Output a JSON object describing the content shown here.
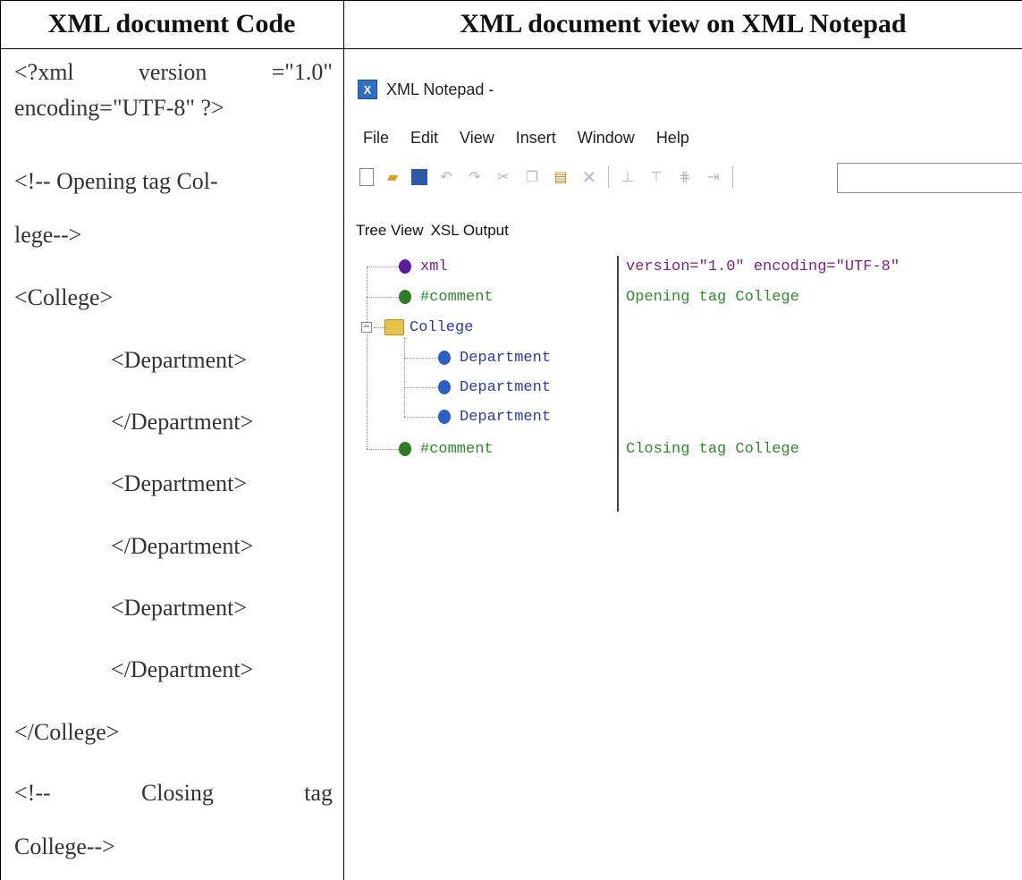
{
  "headers": {
    "left": "XML document Code",
    "right": "XML document view on XML Notepad"
  },
  "code": {
    "l1a": "<?xml",
    "l1b": "version",
    "l1c": "=\"1.0\"",
    "l2": "encoding=\"UTF-8\" ?>",
    "l3": "<!-- Opening tag Col-",
    "l4": "lege-->",
    "l5": "<College>",
    "l6": "<Department>",
    "l7": "</Department>",
    "l8": "<Department>",
    "l9": "</Department>",
    "l10": "<Department>",
    "l11": "</Department>",
    "l12": "</College>",
    "l13a": "<!--",
    "l13b": "Closing",
    "l13c": "tag",
    "l14": "College-->"
  },
  "notepad": {
    "title": "XML Notepad -",
    "app_icon": "X",
    "menu": [
      "File",
      "Edit",
      "View",
      "Insert",
      "Window",
      "Help"
    ],
    "tabs": [
      "Tree View",
      "XSL Output"
    ],
    "tree": {
      "n1": "xml",
      "n2": "#comment",
      "n3": "College",
      "n4": "Department",
      "n5": "Department",
      "n6": "Department",
      "n7": "#comment"
    },
    "values": {
      "v1": "version=\"1.0\" encoding=\"UTF-8\"",
      "v2": "Opening tag College",
      "v7": "Closing tag College"
    },
    "expander_glyph": "−"
  }
}
